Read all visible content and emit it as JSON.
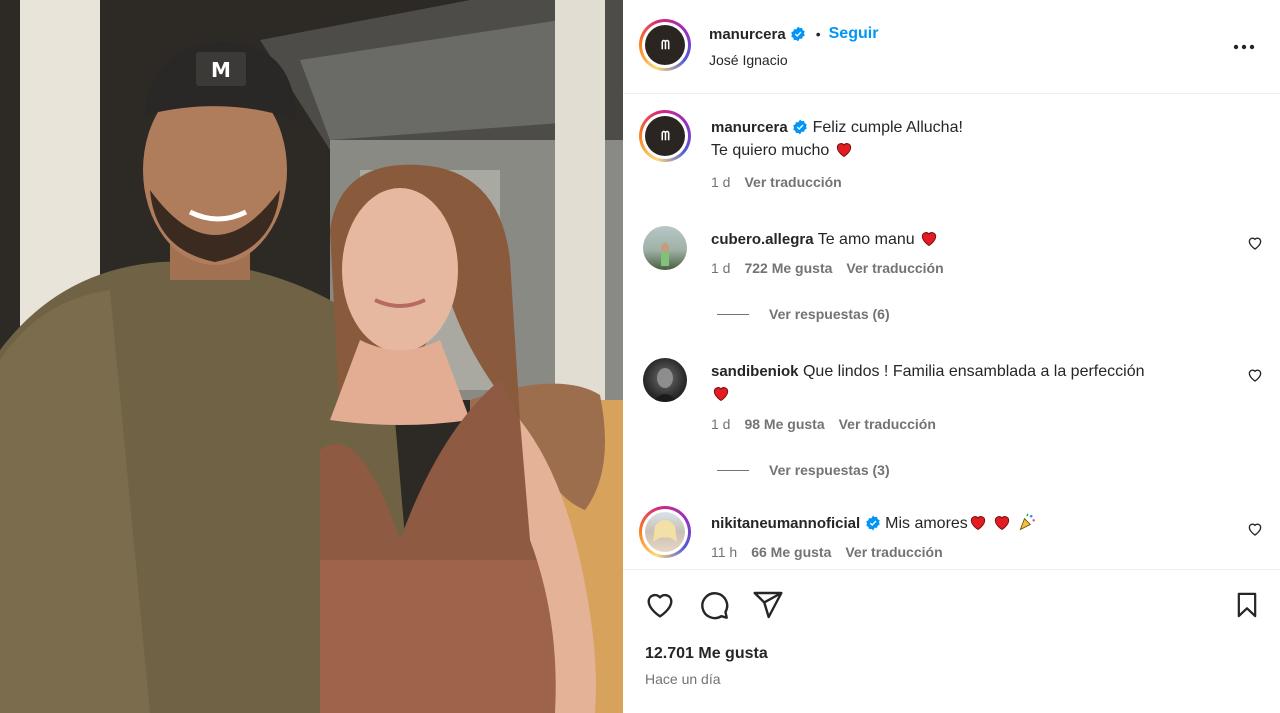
{
  "post": {
    "username": "manurcera",
    "follow_label": "Seguir",
    "location": "José Ignacio",
    "more_label": "More options"
  },
  "caption": {
    "username": "manurcera",
    "text_line1": "Feliz cumple Allucha!",
    "text_line2": "Te quiero mucho",
    "time": "1 d",
    "translate": "Ver traducción"
  },
  "comments": [
    {
      "username": "cubero.allegra",
      "text": "Te amo manu",
      "time": "1 d",
      "likes": "722 Me gusta",
      "translate": "Ver traducción",
      "replies": "Ver respuestas (6)"
    },
    {
      "username": "sandibeniok",
      "text": "Que lindos ! Familia ensamblada a la perfección",
      "time": "1 d",
      "likes": "98 Me gusta",
      "translate": "Ver traducción",
      "replies": "Ver respuestas (3)"
    },
    {
      "username": "nikitaneumannoficial",
      "text": "Mis amores",
      "time": "11 h",
      "likes": "66 Me gusta",
      "translate": "Ver traducción"
    }
  ],
  "footer": {
    "likes": "12.701 Me gusta",
    "time_ago": "Hace un día"
  },
  "colors": {
    "accent": "#0095f6",
    "text": "#262626",
    "secondary": "#737373",
    "heart": "#e31b23"
  },
  "icons": [
    "verified-badge-icon",
    "more-options-icon",
    "heart-outline-icon",
    "comment-icon",
    "share-icon",
    "bookmark-icon",
    "red-heart-emoji-icon",
    "party-popper-emoji-icon"
  ]
}
